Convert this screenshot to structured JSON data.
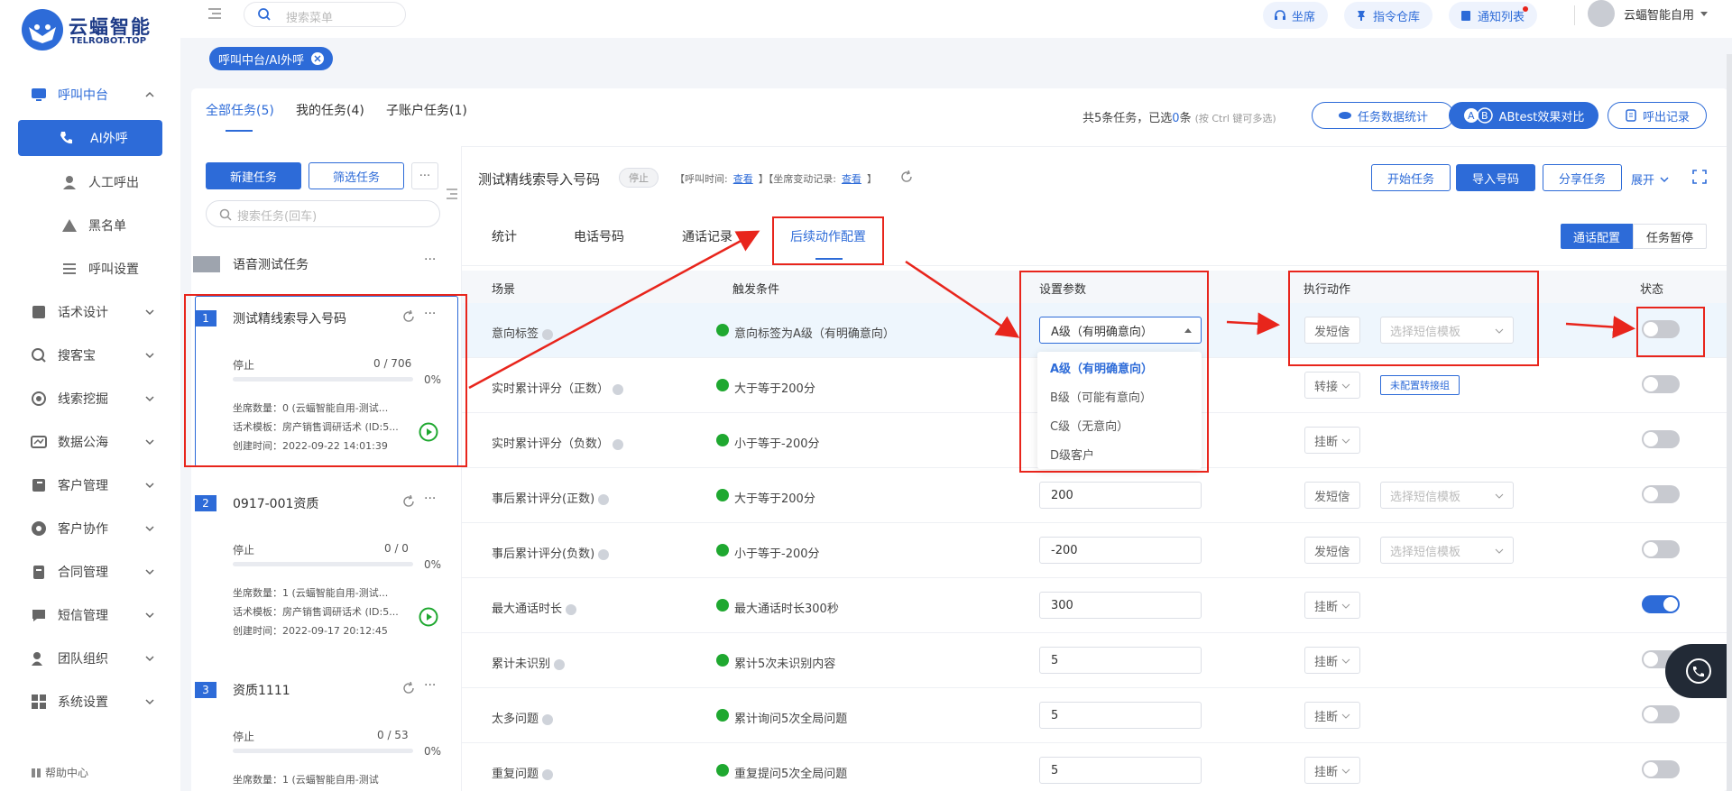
{
  "brand": {
    "name": "云蝠智能",
    "sub": "TELROBOT.TOP"
  },
  "sidebar": {
    "items": [
      {
        "label": "呼叫中台",
        "icon": "monitor-icon"
      },
      {
        "label": "AI外呼",
        "icon": "phone-icon",
        "active": true
      },
      {
        "label": "人工呼出",
        "icon": "person-icon"
      },
      {
        "label": "黑名单",
        "icon": "warning-icon"
      },
      {
        "label": "呼叫设置",
        "icon": "sliders-icon"
      },
      {
        "label": "话术设计",
        "icon": "book-icon"
      },
      {
        "label": "搜客宝",
        "icon": "search-icon"
      },
      {
        "label": "线索挖掘",
        "icon": "radar-icon"
      },
      {
        "label": "数据公海",
        "icon": "chart-icon"
      },
      {
        "label": "客户管理",
        "icon": "contact-icon"
      },
      {
        "label": "客户协作",
        "icon": "team-icon"
      },
      {
        "label": "合同管理",
        "icon": "clipboard-icon"
      },
      {
        "label": "短信管理",
        "icon": "message-icon"
      },
      {
        "label": "团队组织",
        "icon": "group-icon"
      },
      {
        "label": "系统设置",
        "icon": "grid-icon"
      }
    ],
    "help": "帮助中心"
  },
  "topbar": {
    "search_placeholder": "搜索菜单",
    "pills": [
      "坐席",
      "指令仓库",
      "通知列表"
    ],
    "user": "云蝠智能自用"
  },
  "tag": "呼叫中台/AI外呼",
  "main_tabs": [
    "全部任务(5)",
    "我的任务(4)",
    "子账户任务(1)"
  ],
  "selection_info": {
    "prefix": "共5条任务，已选",
    "count": "0",
    "suffix": "条",
    "hint": "(按 Ctrl 键可多选)"
  },
  "header_buttons": {
    "stats": "任务数据统计",
    "abtest": "ABtest效果对比",
    "records": "呼出记录"
  },
  "task_list": {
    "new_btn": "新建任务",
    "filter_btn": "筛选任务",
    "more": "···",
    "search_placeholder": "搜索任务(回车)",
    "group": "语音测试任务",
    "tasks": [
      {
        "num": "1",
        "title": "测试精线索导入号码",
        "status": "停止",
        "count": "0 / 706",
        "pct": "0%",
        "seats": "坐席数量：0 (云蝠智能自用-测试...",
        "template": "话术模板：房产销售调研话术 (ID:5...",
        "created": "创建时间：2022-09-22 14:01:39"
      },
      {
        "num": "2",
        "title": "0917-001资质",
        "status": "停止",
        "count": "0 / 0",
        "pct": "0%",
        "seats": "坐席数量：1 (云蝠智能自用-测试...",
        "template": "话术模板：房产销售调研话术 (ID:5...",
        "created": "创建时间：2022-09-17 20:12:45"
      },
      {
        "num": "3",
        "title": "资质1111",
        "status": "停止",
        "count": "0 / 53",
        "pct": "0%",
        "seats": "坐席数量：1 (云蝠智能自用-测试"
      }
    ]
  },
  "detail": {
    "title": "测试精线索导入号码",
    "status": "停止",
    "call_time_label": "【呼叫时间:",
    "view": "查看",
    "seat_change_label": "】【坐席变动记录:",
    "close_bracket": "】",
    "buttons": {
      "start": "开始任务",
      "import": "导入号码",
      "share": "分享任务",
      "expand": "展开"
    },
    "tabs": [
      "统计",
      "电话号码",
      "通话记录",
      "后续动作配置"
    ],
    "toggle": [
      "通话配置",
      "任务暂停"
    ]
  },
  "table": {
    "headers": [
      "场景",
      "触发条件",
      "设置参数",
      "执行动作",
      "状态"
    ],
    "rows": [
      {
        "scene": "意向标签",
        "trigger": "意向标签为A级（有明确意向）",
        "param": "A级（有明确意向）",
        "action": "发短信",
        "action2": "选择短信模板",
        "on": false
      },
      {
        "scene": "实时累计评分（正数）",
        "trigger": "大于等于200分",
        "param": "",
        "action": "转接",
        "action2": "未配置转接组",
        "on": false
      },
      {
        "scene": "实时累计评分（负数）",
        "trigger": "小于等于-200分",
        "param": "",
        "action": "挂断",
        "on": false
      },
      {
        "scene": "事后累计评分(正数)",
        "trigger": "大于等于200分",
        "param": "200",
        "action": "发短信",
        "action2": "选择短信模板",
        "on": false
      },
      {
        "scene": "事后累计评分(负数)",
        "trigger": "小于等于-200分",
        "param": "-200",
        "action": "发短信",
        "action2": "选择短信模板",
        "on": false
      },
      {
        "scene": "最大通话时长",
        "trigger": "最大通话时长300秒",
        "param": "300",
        "action": "挂断",
        "on": true
      },
      {
        "scene": "累计未识别",
        "trigger": "累计5次未识别内容",
        "param": "5",
        "action": "挂断",
        "on": false
      },
      {
        "scene": "太多问题",
        "trigger": "累计询问5次全局问题",
        "param": "5",
        "action": "挂断",
        "on": false
      },
      {
        "scene": "重复问题",
        "trigger": "重复提问5次全局问题",
        "param": "5",
        "action": "挂断",
        "on": false
      }
    ],
    "dropdown_options": [
      "A级（有明确意向）",
      "B级（可能有意向）",
      "C级（无意向）",
      "D级客户"
    ]
  },
  "colors": {
    "primary": "#2d6bd8",
    "annotation": "#e8251c",
    "success": "#1fa830"
  }
}
